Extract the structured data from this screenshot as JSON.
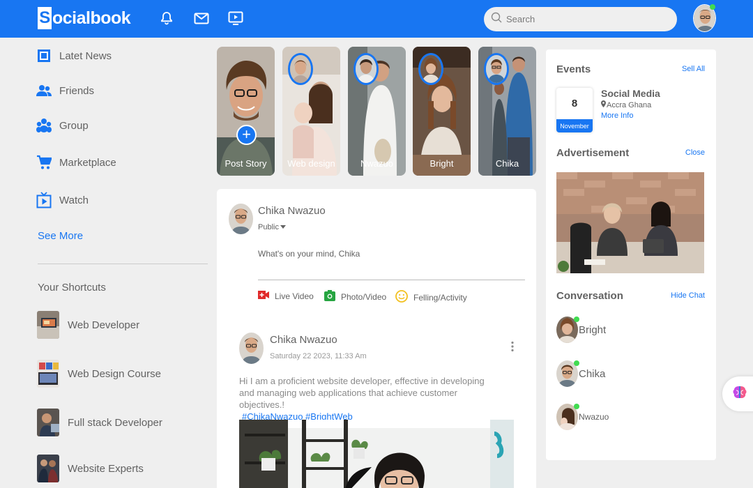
{
  "brand": {
    "logo_letter": "S",
    "logo_rest": "ocialbook"
  },
  "colors": {
    "primary": "#1876f2",
    "online": "#41db51"
  },
  "nav": {
    "icons": [
      "bell-icon",
      "mail-icon",
      "video-icon"
    ],
    "search_placeholder": "Search"
  },
  "sidebar": {
    "items": [
      {
        "label": "Latet News",
        "icon": "news-icon"
      },
      {
        "label": "Friends",
        "icon": "friends-icon"
      },
      {
        "label": "Group",
        "icon": "group-icon"
      },
      {
        "label": "Marketplace",
        "icon": "cart-icon"
      },
      {
        "label": "Watch",
        "icon": "watch-icon"
      }
    ],
    "see_more": "See More",
    "shortcuts_title": "Your Shortcuts",
    "shortcuts": [
      {
        "label": "Web Developer"
      },
      {
        "label": "Web Design Course"
      },
      {
        "label": "Full stack Developer"
      },
      {
        "label": "Website Experts"
      }
    ]
  },
  "stories": [
    {
      "label": "Post Story"
    },
    {
      "label": "Web design"
    },
    {
      "label": "Nwazuo"
    },
    {
      "label": "Bright"
    },
    {
      "label": "Chika"
    }
  ],
  "composer": {
    "user_name": "Chika Nwazuo",
    "privacy": "Public",
    "placeholder": "What's on your mind, Chika",
    "actions": [
      {
        "label": "Live Video",
        "icon": "live-video-icon",
        "color": "#e02a2a"
      },
      {
        "label": "Photo/Video",
        "icon": "camera-icon",
        "color": "#26a541"
      },
      {
        "label": "Felling/Activity",
        "icon": "smiley-icon",
        "color": "#f2c01f"
      }
    ]
  },
  "post": {
    "user_name": "Chika Nwazuo",
    "timestamp": "Saturday 22 2023, 11:33 Am",
    "text": "Hi I am a proficient website developer, effective in developing and managing web applications that achieve customer objectives.!",
    "hashtags": "#ChikaNwazuo #BrightWeb"
  },
  "events": {
    "title": "Events",
    "see_all": "Sell All",
    "day": "8",
    "month": "November",
    "name": "Social Media",
    "location": "Accra Ghana",
    "more_info": "More Info"
  },
  "advertisement": {
    "title": "Advertisement",
    "close": "Close"
  },
  "conversation": {
    "title": "Conversation",
    "hide": "Hide Chat",
    "contacts": [
      {
        "name": "Bright"
      },
      {
        "name": "Chika"
      },
      {
        "name": "Nwazuo"
      }
    ]
  }
}
